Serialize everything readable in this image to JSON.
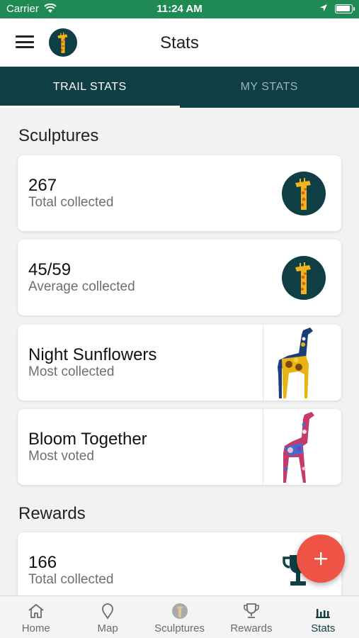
{
  "status_bar": {
    "carrier": "Carrier",
    "time": "11:24 AM"
  },
  "app_bar": {
    "title": "Stats"
  },
  "tabs": [
    {
      "label": "TRAIL STATS",
      "active": true
    },
    {
      "label": "MY STATS",
      "active": false
    }
  ],
  "sculptures_section": {
    "title": "Sculptures",
    "cards": [
      {
        "value": "267",
        "label": "Total collected",
        "icon": "giraffe-logo-icon"
      },
      {
        "value": "45/59",
        "label": "Average collected",
        "icon": "giraffe-logo-icon"
      },
      {
        "value": "Night Sunflowers",
        "label": "Most collected",
        "image": "sunflower-giraffe-sculpture"
      },
      {
        "value": "Bloom Together",
        "label": "Most voted",
        "image": "floral-giraffe-sculpture"
      }
    ]
  },
  "rewards_section": {
    "title": "Rewards",
    "cards": [
      {
        "value": "166",
        "label": "Total collected",
        "icon": "trophy-icon"
      }
    ]
  },
  "fab": {
    "icon": "plus-icon"
  },
  "bottom_nav": [
    {
      "label": "Home",
      "icon": "home-icon",
      "active": false
    },
    {
      "label": "Map",
      "icon": "map-pin-icon",
      "active": false
    },
    {
      "label": "Sculptures",
      "icon": "sculpture-icon",
      "active": false
    },
    {
      "label": "Rewards",
      "icon": "trophy-icon",
      "active": false
    },
    {
      "label": "Stats",
      "icon": "bar-chart-icon",
      "active": true
    }
  ],
  "colors": {
    "status_bar": "#1f8a54",
    "tab_bar": "#0f3f45",
    "logo_bg": "#0f3f45",
    "giraffe_yellow": "#f2b417",
    "giraffe_orange": "#e2571e",
    "fab": "#ee5345"
  }
}
